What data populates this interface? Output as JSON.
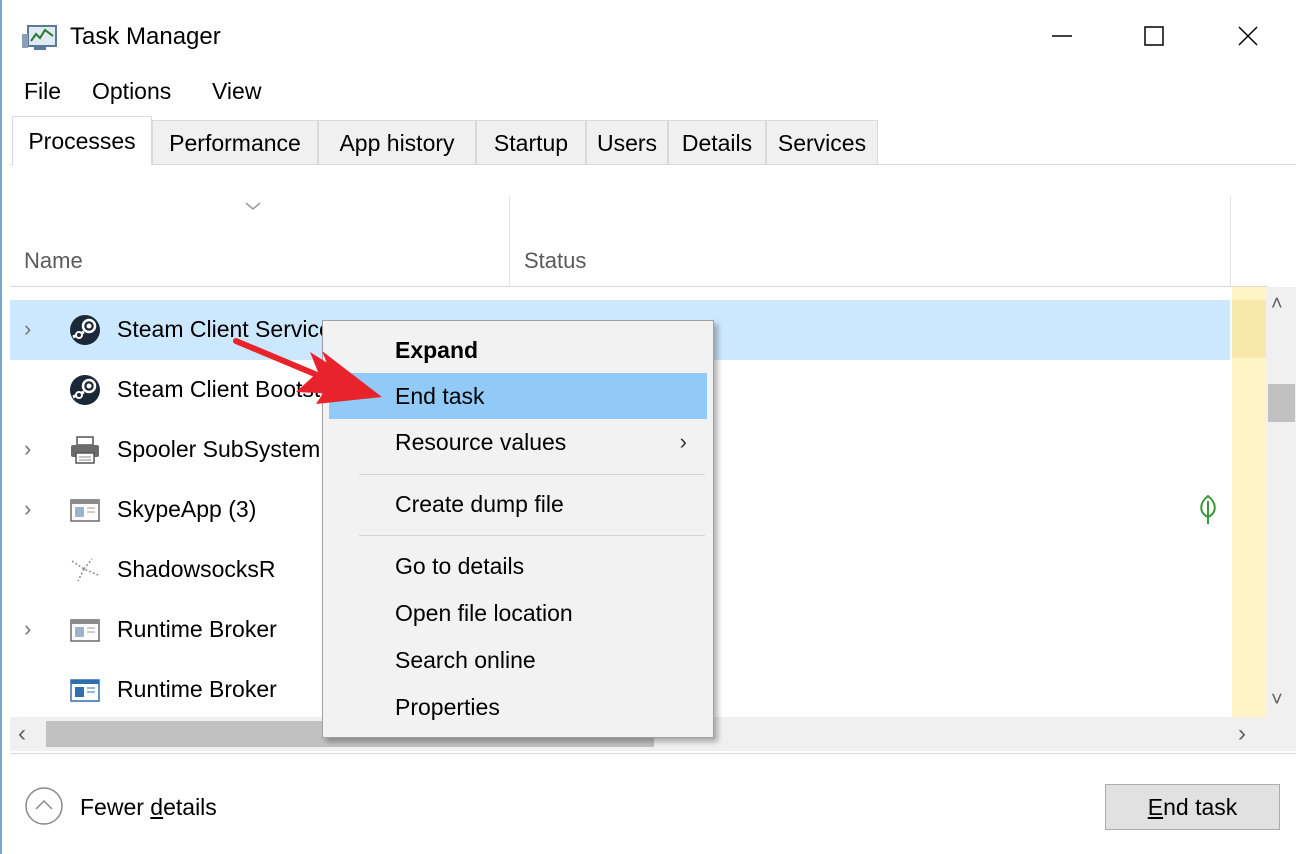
{
  "window": {
    "title": "Task Manager",
    "controls": {
      "minimize": "minimize-icon",
      "maximize": "maximize-icon",
      "close": "close-icon"
    }
  },
  "menu": [
    "File",
    "Options",
    "View"
  ],
  "tabs": [
    {
      "label": "Processes",
      "active": true
    },
    {
      "label": "Performance"
    },
    {
      "label": "App history"
    },
    {
      "label": "Startup"
    },
    {
      "label": "Users"
    },
    {
      "label": "Details"
    },
    {
      "label": "Services"
    }
  ],
  "columns": {
    "name": "Name",
    "status": "Status"
  },
  "processes": [
    {
      "name": "Steam Client Service",
      "expandable": true,
      "selected": true,
      "icon": "steam-icon"
    },
    {
      "name": "Steam Client Bootstrapper",
      "expandable": false,
      "icon": "steam-icon"
    },
    {
      "name": "Spooler SubSystem App",
      "expandable": true,
      "icon": "printer-icon"
    },
    {
      "name": "SkypeApp (3)",
      "expandable": true,
      "icon": "app-window-icon",
      "status_icon": "leaf-icon"
    },
    {
      "name": "ShadowsocksR",
      "expandable": false,
      "icon": "shadowsocks-icon"
    },
    {
      "name": "Runtime Broker",
      "expandable": true,
      "icon": "app-window-icon"
    },
    {
      "name": "Runtime Broker",
      "expandable": false,
      "icon": "app-window-blue-icon"
    }
  ],
  "context_menu": {
    "items": [
      {
        "label": "Expand",
        "bold": true
      },
      {
        "label": "End task",
        "highlighted": true
      },
      {
        "label": "Resource values",
        "submenu": true
      },
      {
        "label": "Create dump file"
      },
      {
        "label": "Go to details"
      },
      {
        "label": "Open file location"
      },
      {
        "label": "Search online"
      },
      {
        "label": "Properties"
      }
    ]
  },
  "footer": {
    "fewer_details_prefix": "Fewer ",
    "fewer_details_mnemonic": "d",
    "fewer_details_suffix": "etails",
    "end_task_mnemonic": "E",
    "end_task_suffix": "nd task"
  },
  "colors": {
    "selection": "#cce8ff",
    "menu_highlight": "#91c9f7",
    "resource_column": "#fff4c4",
    "annotation_arrow": "#e8232b"
  }
}
